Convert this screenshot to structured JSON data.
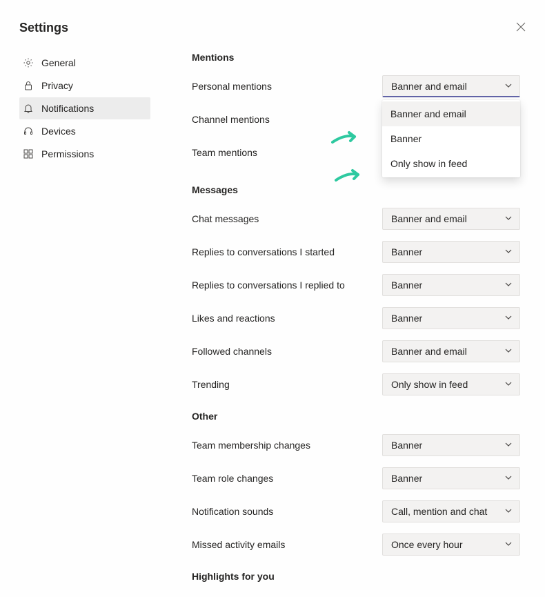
{
  "header": {
    "title": "Settings"
  },
  "sidebar": {
    "items": [
      {
        "label": "General"
      },
      {
        "label": "Privacy"
      },
      {
        "label": "Notifications"
      },
      {
        "label": "Devices"
      },
      {
        "label": "Permissions"
      }
    ]
  },
  "sections": {
    "mentions": {
      "heading": "Mentions",
      "rows": [
        {
          "label": "Personal mentions",
          "value": "Banner and email"
        },
        {
          "label": "Channel mentions",
          "value": ""
        },
        {
          "label": "Team mentions",
          "value": ""
        }
      ],
      "dropdown_options": [
        "Banner and email",
        "Banner",
        "Only show in feed"
      ]
    },
    "messages": {
      "heading": "Messages",
      "rows": [
        {
          "label": "Chat messages",
          "value": "Banner and email"
        },
        {
          "label": "Replies to conversations I started",
          "value": "Banner"
        },
        {
          "label": "Replies to conversations I replied to",
          "value": "Banner"
        },
        {
          "label": "Likes and reactions",
          "value": "Banner"
        },
        {
          "label": "Followed channels",
          "value": "Banner and email"
        },
        {
          "label": "Trending",
          "value": "Only show in feed"
        }
      ]
    },
    "other": {
      "heading": "Other",
      "rows": [
        {
          "label": "Team membership changes",
          "value": "Banner"
        },
        {
          "label": "Team role changes",
          "value": "Banner"
        },
        {
          "label": "Notification sounds",
          "value": "Call, mention and chat"
        },
        {
          "label": "Missed activity emails",
          "value": "Once every hour"
        }
      ]
    },
    "highlights": {
      "heading": "Highlights for you"
    }
  }
}
